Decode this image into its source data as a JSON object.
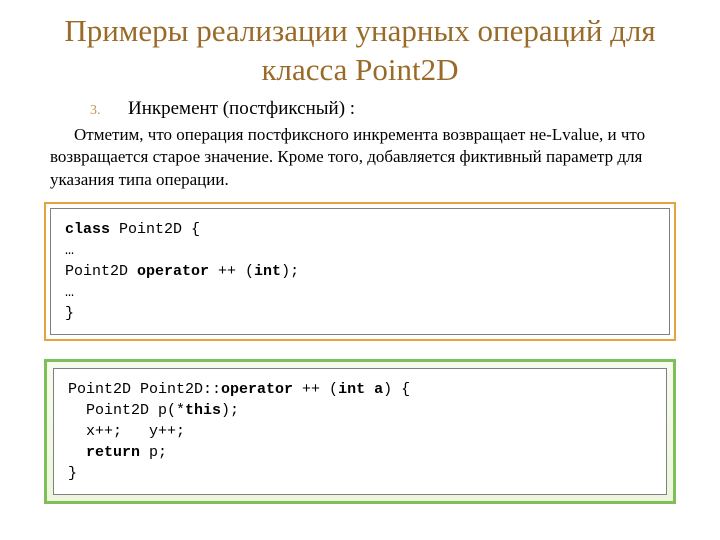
{
  "title": "Примеры реализации унарных операций для класса Point2D",
  "bullet": {
    "number": "3.",
    "text": "Инкремент  (постфиксный) :"
  },
  "paragraph": "Отметим, что операция постфиксного инкремента возвращает не-Lvalue, и что возвращается старое значение. Кроме того, добавляется фиктивный параметр для указания типа операции.",
  "code1": {
    "l1a": "class",
    "l1b": " Point2D {",
    "l2": "…",
    "l3a": "Point2D ",
    "l3b": "operator",
    "l3c": " ++ (",
    "l3d": "int",
    "l3e": ");",
    "l4": "…",
    "l5": "}"
  },
  "code2": {
    "l1a": "Point2D Point2D::",
    "l1b": "operator",
    "l1c": " ++ (",
    "l1d": "int a",
    "l1e": ") {",
    "l2a": "  Point2D p(*",
    "l2b": "this",
    "l2c": ");",
    "l3": "  x++;   y++;",
    "l4a": "  ",
    "l4b": "return",
    "l4c": " p;",
    "l5": "}"
  }
}
